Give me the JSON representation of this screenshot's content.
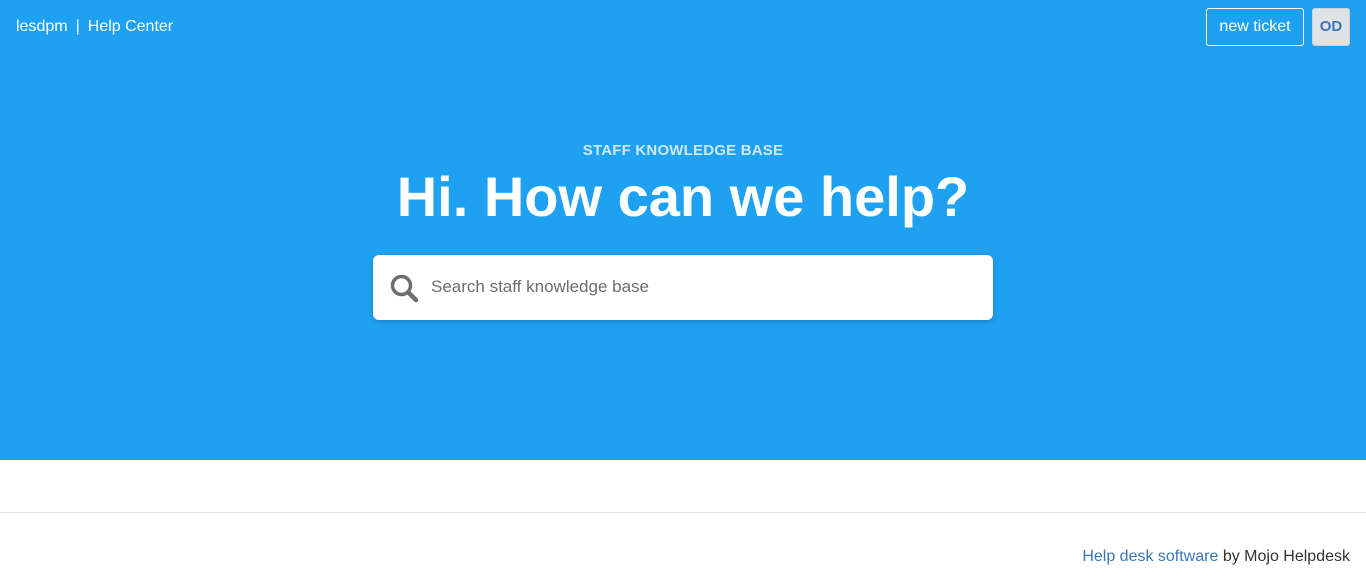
{
  "header": {
    "org_name": "lesdpm",
    "separator": "|",
    "help_center_label": "Help Center",
    "new_ticket_label": "new ticket",
    "avatar_initials": "OD"
  },
  "hero": {
    "eyebrow": "STAFF KNOWLEDGE BASE",
    "headline": "Hi. How can we help?",
    "search": {
      "placeholder": "Search staff knowledge base",
      "value": "",
      "icon": "search-icon"
    }
  },
  "footer": {
    "link_label": "Help desk software",
    "suffix": " by Mojo Helpdesk"
  },
  "colors": {
    "hero_background": "#1fa1f2",
    "link": "#3a77b3",
    "avatar_background": "#dfe3e8"
  }
}
